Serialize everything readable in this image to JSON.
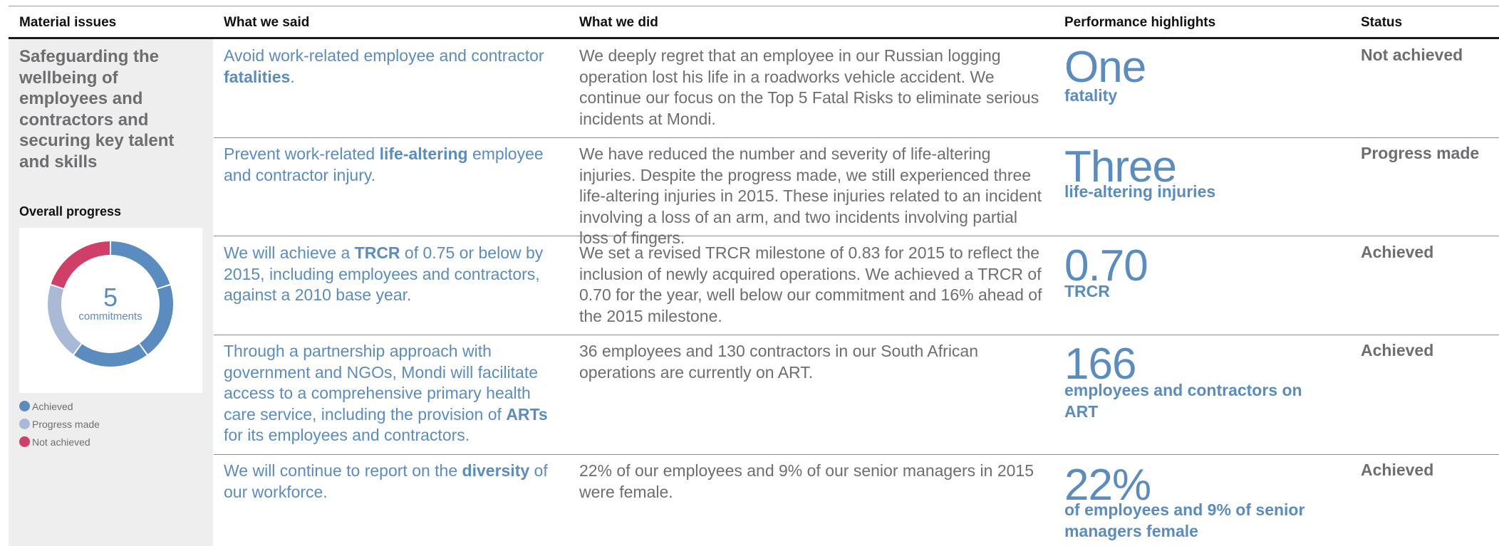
{
  "header": {
    "col1": "Material issues",
    "col2": "What we said",
    "col3": "What we did",
    "col4": "Performance highlights",
    "col5": "Status"
  },
  "issue": "Safeguarding the wellbeing of employees and contractors and securing key talent and skills",
  "progress": {
    "title": "Overall progress",
    "center_value": "5",
    "center_label": "commitments",
    "counts": {
      "achieved": 3,
      "progress_made": 1,
      "not_achieved": 1
    },
    "legend": [
      "Achieved",
      "Progress made",
      "Not achieved"
    ],
    "colors": {
      "achieved": "#5b8cbf",
      "progress_made": "#a9bad6",
      "not_achieved": "#cf3f67"
    }
  },
  "rows": [
    {
      "said_pre": "Avoid work-related employee and contractor ",
      "said_bold": "fatalities",
      "said_post": ".",
      "did": "We deeply regret that an employee in our Russian logging operation lost his life in a roadworks vehicle accident. We continue our focus on the Top 5 Fatal Risks to eliminate serious incidents at Mondi.",
      "big": "One",
      "sub": "fatality",
      "status": "Not achieved"
    },
    {
      "said_pre": "Prevent work-related ",
      "said_bold": "life-altering",
      "said_post": " employee and contractor injury.",
      "did": "We have reduced the number and severity of life-altering injuries. Despite the progress made, we still experienced three life-altering injuries in 2015. These injuries related to an incident involving a loss of an arm, and two incidents involving partial loss of fingers.",
      "big": "Three",
      "sub": "life-altering injuries",
      "status": "Progress made"
    },
    {
      "said_pre": "We will achieve a ",
      "said_bold": "TRCR",
      "said_post": " of 0.75 or below by 2015, including employees and contractors, against a 2010 base year.",
      "did": "We set a revised TRCR milestone of 0.83 for 2015 to reflect the inclusion of newly acquired operations. We achieved a TRCR of 0.70 for the year, well below our commitment and 16% ahead of the 2015 milestone.",
      "big": "0.70",
      "sub": "TRCR",
      "status": "Achieved"
    },
    {
      "said_pre": "Through a partnership approach with government and NGOs, Mondi will facilitate access to a comprehensive primary health care service, including the provision of ",
      "said_bold": "ARTs",
      "said_post": " for its employees and contractors.",
      "did": "36 employees and 130 contractors in our South African operations are currently on ART.",
      "big": "166",
      "sub": "employees and contractors on ART",
      "status": "Achieved"
    },
    {
      "said_pre": "We will continue to report on the ",
      "said_bold": "diversity",
      "said_post": " of our workforce.",
      "did": "22% of our employees and 9% of our senior managers in 2015 were female.",
      "big": "22%",
      "sub": "of employees and 9% of senior managers female",
      "status": "Achieved"
    }
  ]
}
